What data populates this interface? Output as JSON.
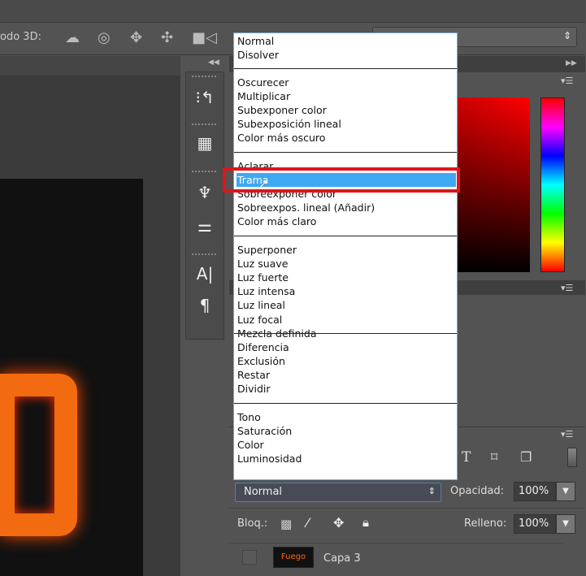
{
  "options_bar": {
    "mode_3d_label": "odo 3D:",
    "right_select_value": "."
  },
  "tools": [
    {
      "icon": "history-icon"
    },
    {
      "icon": "3d-object-icon"
    },
    {
      "icon": "brushes-icon"
    },
    {
      "icon": "adjust-icon"
    },
    {
      "icon": "character-icon",
      "glyph": "A|"
    },
    {
      "icon": "paragraph-icon",
      "glyph": "¶"
    }
  ],
  "blend_menu": {
    "groups": [
      [
        "Normal",
        "Disolver"
      ],
      [
        "Oscurecer",
        "Multiplicar",
        "Subexponer color",
        "Subexposición lineal",
        "Color más oscuro"
      ],
      [
        "Aclarar",
        "Trama",
        "Sobreexponer color",
        "Sobreexpos. lineal (Añadir)",
        "Color más claro"
      ],
      [
        "Superponer",
        "Luz suave",
        "Luz fuerte",
        "Luz intensa",
        "Luz lineal",
        "Luz focal",
        "Mezcla definida"
      ],
      [
        "Diferencia",
        "Exclusión",
        "Restar",
        "Dividir"
      ],
      [
        "Tono",
        "Saturación",
        "Color",
        "Luminosidad"
      ]
    ],
    "highlighted": "Trama",
    "annotation_color": "#e0141b"
  },
  "layers": {
    "blend_mode": "Normal",
    "opacity_label": "Opacidad:",
    "opacity": "100%",
    "lock_label": "Bloq.:",
    "fill_label": "Relleno:",
    "fill": "100%",
    "layer_name": "Capa 3",
    "thumb_text": "Fuego"
  }
}
